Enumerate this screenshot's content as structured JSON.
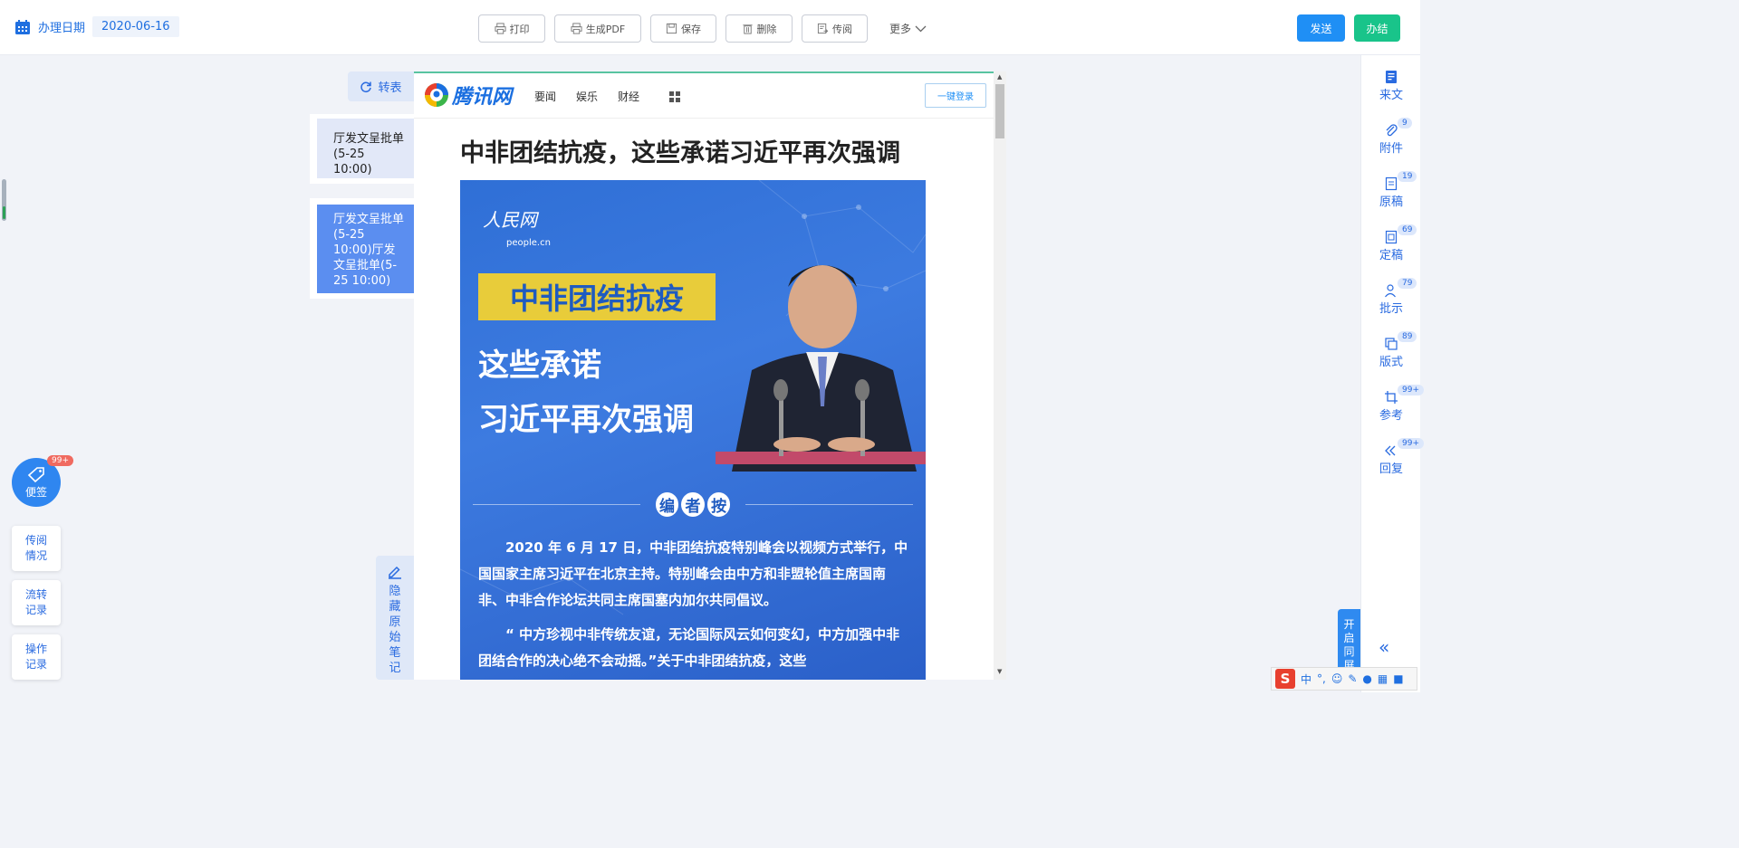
{
  "header": {
    "date_label": "办理日期",
    "date_value": "2020-06-16",
    "tools": [
      "打印",
      "生成PDF",
      "保存",
      "删除",
      "传阅"
    ],
    "more_label": "更多",
    "send_label": "发送",
    "done_label": "办结"
  },
  "left": {
    "zhuanbiao_label": "转表",
    "items": [
      "厅发文呈批单(5-25 10:00)",
      "厅发文呈批单(5-25 10:00)厅发文呈批单(5-25 10:00)"
    ],
    "sticker_label": "便签",
    "sticker_badge": "99+",
    "cards": [
      "传阅情况",
      "流转记录",
      "操作记录"
    ],
    "hide_notes_label": "隐藏原始笔记"
  },
  "doc": {
    "site_name": "腾讯网",
    "nav": [
      "要闻",
      "娱乐",
      "财经"
    ],
    "login_label": "一键登录",
    "title": "中非团结抗疫，这些承诺习近平再次强调",
    "hero": {
      "logo_cn": "人民网",
      "logo_en": "people.cn",
      "tag": "中非团结抗疫",
      "line1": "这些承诺",
      "line2": "习近平再次强调",
      "editor_chars": [
        "编",
        "者",
        "按"
      ],
      "para1": "2020 年 6 月 17 日，中非团结抗疫特别峰会以视频方式举行，中国国家主席习近平在北京主持。特别峰会由中方和非盟轮值主席国南非、中非合作论坛共同主席国塞内加尔共同倡议。",
      "para2": "“ 中方珍视中非传统友谊，无论国际风云如何变幻，中方加强中非团结合作的决心绝不会动摇。”关于中非团结抗疫，这些"
    }
  },
  "right": {
    "items": [
      {
        "label": "来文",
        "badge": ""
      },
      {
        "label": "附件",
        "badge": "9"
      },
      {
        "label": "原稿",
        "badge": "19"
      },
      {
        "label": "定稿",
        "badge": "69"
      },
      {
        "label": "批示",
        "badge": "79"
      },
      {
        "label": "版式",
        "badge": "89"
      },
      {
        "label": "参考",
        "badge": "99+"
      },
      {
        "label": "回复",
        "badge": "99+"
      }
    ],
    "sync_label": "开启同屏"
  },
  "ime": {
    "mode": "中"
  }
}
